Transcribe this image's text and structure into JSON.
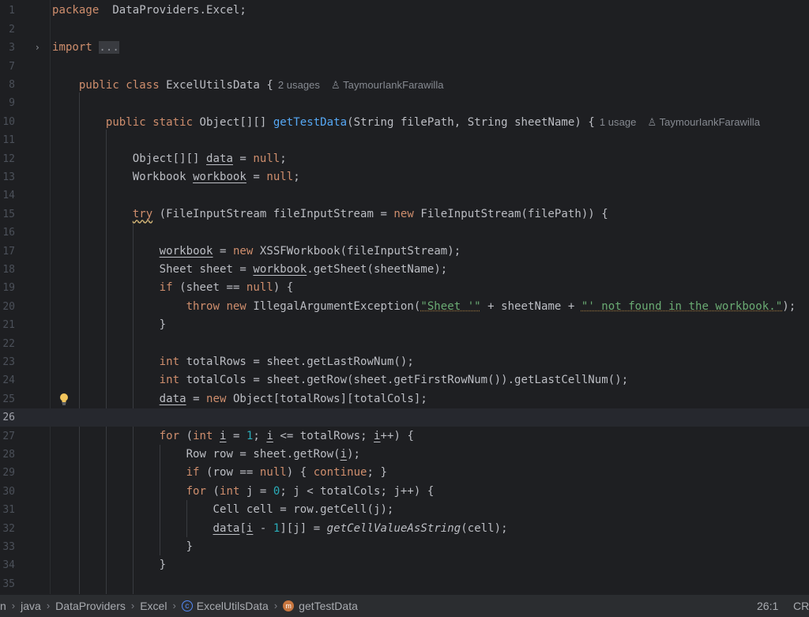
{
  "editor": {
    "current_line": 26,
    "lines": [
      {
        "num": "1",
        "tokens": [
          [
            "k",
            "package"
          ],
          [
            "",
            "  DataProviders.Excel;"
          ]
        ]
      },
      {
        "num": "2",
        "tokens": []
      },
      {
        "num": "3",
        "fold": true,
        "tokens": [
          [
            "k",
            "import"
          ],
          [
            "",
            " "
          ],
          [
            "fold",
            "..."
          ]
        ]
      },
      {
        "num": "7",
        "tokens": []
      },
      {
        "num": "8",
        "tokens": [
          [
            "",
            "    "
          ],
          [
            "k",
            "public class"
          ],
          [
            "",
            " ExcelUtilsData {"
          ]
        ],
        "hint": {
          "usages": "2 usages",
          "author": "TaymourIankFarawilla"
        }
      },
      {
        "num": "9",
        "tokens": []
      },
      {
        "num": "10",
        "tokens": [
          [
            "",
            "        "
          ],
          [
            "k",
            "public static"
          ],
          [
            "",
            " Object[][] "
          ],
          [
            "f",
            "getTestData"
          ],
          [
            "",
            "(String filePath, String sheetName) {"
          ]
        ],
        "hint": {
          "usages": "1 usage",
          "author": "TaymourIankFarawilla"
        }
      },
      {
        "num": "11",
        "tokens": []
      },
      {
        "num": "12",
        "tokens": [
          [
            "",
            "            Object[][] "
          ],
          [
            "u",
            "data"
          ],
          [
            "",
            " = "
          ],
          [
            "k",
            "null"
          ],
          [
            "",
            ";"
          ]
        ]
      },
      {
        "num": "13",
        "tokens": [
          [
            "",
            "            Workbook "
          ],
          [
            "u",
            "workbook"
          ],
          [
            "",
            " = "
          ],
          [
            "k",
            "null"
          ],
          [
            "",
            ";"
          ]
        ]
      },
      {
        "num": "14",
        "tokens": []
      },
      {
        "num": "15",
        "tokens": [
          [
            "",
            "            "
          ],
          [
            "k w",
            "try"
          ],
          [
            "",
            " (FileInputStream fileInputStream = "
          ],
          [
            "k",
            "new"
          ],
          [
            "",
            " FileInputStream(filePath)) {"
          ]
        ]
      },
      {
        "num": "16",
        "tokens": []
      },
      {
        "num": "17",
        "tokens": [
          [
            "",
            "                "
          ],
          [
            "u",
            "workbook"
          ],
          [
            "",
            " = "
          ],
          [
            "k",
            "new"
          ],
          [
            "",
            " XSSFWorkbook(fileInputStream);"
          ]
        ]
      },
      {
        "num": "18",
        "tokens": [
          [
            "",
            "                Sheet sheet = "
          ],
          [
            "u",
            "workbook"
          ],
          [
            "",
            ".getSheet(sheetName);"
          ]
        ]
      },
      {
        "num": "19",
        "tokens": [
          [
            "",
            "                "
          ],
          [
            "k",
            "if"
          ],
          [
            "",
            " (sheet == "
          ],
          [
            "k",
            "null"
          ],
          [
            "",
            ") {"
          ]
        ]
      },
      {
        "num": "20",
        "tokens": [
          [
            "",
            "                    "
          ],
          [
            "k",
            "throw new"
          ],
          [
            "",
            " IllegalArgumentException("
          ],
          [
            "s",
            "\"Sheet '\""
          ],
          [
            "",
            " + sheetName + "
          ],
          [
            "s",
            "\"' not found in the workbook.\""
          ],
          [
            "",
            ");"
          ]
        ]
      },
      {
        "num": "21",
        "tokens": [
          [
            "",
            "                }"
          ]
        ]
      },
      {
        "num": "22",
        "tokens": []
      },
      {
        "num": "23",
        "tokens": [
          [
            "",
            "                "
          ],
          [
            "k",
            "int"
          ],
          [
            "",
            " totalRows = sheet.getLastRowNum();"
          ]
        ]
      },
      {
        "num": "24",
        "tokens": [
          [
            "",
            "                "
          ],
          [
            "k",
            "int"
          ],
          [
            "",
            " totalCols = sheet.getRow(sheet.getFirstRowNum()).getLastCellNum();"
          ]
        ]
      },
      {
        "num": "25",
        "bulb": true,
        "tokens": [
          [
            "",
            "                "
          ],
          [
            "u",
            "data"
          ],
          [
            "",
            " = "
          ],
          [
            "k",
            "new"
          ],
          [
            "",
            " Object[totalRows][totalCols];"
          ]
        ]
      },
      {
        "num": "26",
        "tokens": []
      },
      {
        "num": "27",
        "tokens": [
          [
            "",
            "                "
          ],
          [
            "k",
            "for"
          ],
          [
            "",
            " ("
          ],
          [
            "k",
            "int"
          ],
          [
            "",
            " "
          ],
          [
            "u",
            "i"
          ],
          [
            "",
            " = "
          ],
          [
            "n",
            "1"
          ],
          [
            "",
            "; "
          ],
          [
            "u",
            "i"
          ],
          [
            "",
            " <= totalRows; "
          ],
          [
            "u",
            "i"
          ],
          [
            "",
            "++) {"
          ]
        ]
      },
      {
        "num": "28",
        "tokens": [
          [
            "",
            "                    Row row = sheet.getRow("
          ],
          [
            "u",
            "i"
          ],
          [
            "",
            ");"
          ]
        ]
      },
      {
        "num": "29",
        "tokens": [
          [
            "",
            "                    "
          ],
          [
            "k",
            "if"
          ],
          [
            "",
            " (row == "
          ],
          [
            "k",
            "null"
          ],
          [
            "",
            ") { "
          ],
          [
            "k",
            "continue"
          ],
          [
            "",
            "; }"
          ]
        ]
      },
      {
        "num": "30",
        "tokens": [
          [
            "",
            "                    "
          ],
          [
            "k",
            "for"
          ],
          [
            "",
            " ("
          ],
          [
            "k",
            "int"
          ],
          [
            "",
            " j = "
          ],
          [
            "n",
            "0"
          ],
          [
            "",
            "; j < totalCols; j++) {"
          ]
        ]
      },
      {
        "num": "31",
        "tokens": [
          [
            "",
            "                        Cell cell = row.getCell(j);"
          ]
        ]
      },
      {
        "num": "32",
        "tokens": [
          [
            "",
            "                        "
          ],
          [
            "u",
            "data"
          ],
          [
            "",
            "["
          ],
          [
            "u",
            "i"
          ],
          [
            "",
            " - "
          ],
          [
            "n",
            "1"
          ],
          [
            "",
            "][j] = "
          ],
          [
            "i",
            "getCellValueAsString"
          ],
          [
            "",
            "(cell);"
          ]
        ]
      },
      {
        "num": "33",
        "tokens": [
          [
            "",
            "                    }"
          ]
        ]
      },
      {
        "num": "34",
        "tokens": [
          [
            "",
            "                }"
          ]
        ]
      },
      {
        "num": "35",
        "tokens": []
      }
    ]
  },
  "status_bar": {
    "breadcrumbs": [
      {
        "label": "n",
        "icon": null
      },
      {
        "label": "java",
        "icon": null
      },
      {
        "label": "DataProviders",
        "icon": null
      },
      {
        "label": "Excel",
        "icon": null
      },
      {
        "label": "ExcelUtilsData",
        "icon": "class-icon"
      },
      {
        "label": "getTestData",
        "icon": "method-icon"
      }
    ],
    "caret_position": "26:1",
    "line_separator": "CRLF"
  },
  "colors": {
    "background": "#1e1f22",
    "keyword": "#cf8e6d",
    "method_declaration": "#56a8f5",
    "string": "#6aab73",
    "number": "#2aacb8",
    "text": "#bcbec4"
  }
}
